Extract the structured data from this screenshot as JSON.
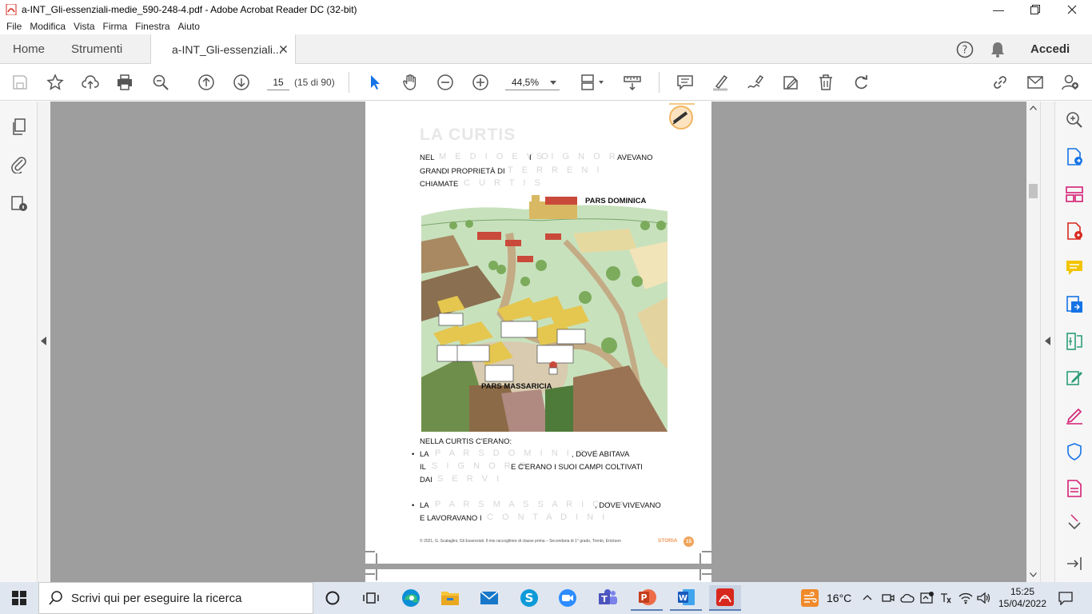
{
  "window": {
    "title": "a-INT_Gli-essenziali-medie_590-248-4.pdf - Adobe Acrobat Reader DC (32-bit)"
  },
  "menu": [
    "File",
    "Modifica",
    "Vista",
    "Firma",
    "Finestra",
    "Aiuto"
  ],
  "tabs": {
    "home": "Home",
    "tools": "Strumenti",
    "doc": "a-INT_Gli-essenziali...",
    "signin": "Accedi"
  },
  "toolbar": {
    "page_current": "15",
    "page_total": "(15 di 90)",
    "zoom": "44,5%"
  },
  "page": {
    "title": "LA CURTIS",
    "line1a": "NEL",
    "line1b": "M E D I O E V O",
    "line1c": "I",
    "line1d": "S I G N O R I",
    "line1e": "AVEVANO",
    "line2a": "GRANDI PROPRIETÀ DI",
    "line2b": "T E R R E N I",
    "line3a": "CHIAMATE",
    "line3b": "C U R T I S",
    "label_dominica": "PARS DOMINICA",
    "label_massaricia": "PARS MASSARICIA",
    "intro": "NELLA CURTIS C'ERANO:",
    "b1a": "LA",
    "b1b": "P A R S   D O M I N I C A",
    "b1c": ", DOVE ABITAVA",
    "b1d": "IL",
    "b1e": "S I G N O R E",
    "b1f": "E C'ERANO I SUOI CAMPI COLTIVATI",
    "b1g": "DAI",
    "b1h": "S E R V I",
    "b2a": "LA",
    "b2b": "P A R S   M A S S A R I C I A",
    "b2c": ", DOVE VIVEVANO",
    "b2d": "E LAVORAVANO I",
    "b2e": "C O N T A D I N I",
    "footer": "© 2021, G. Scalaglini, Gli Essenziali. Il mio raccoglitore di classe prima – Secondaria di 1° grado, Trento, Erickson",
    "section": "STORIA",
    "page_number": "15"
  },
  "taskbar": {
    "search_placeholder": "Scrivi qui per eseguire la ricerca",
    "weather": "16°C",
    "time": "15:25",
    "date": "15/04/2022"
  },
  "colors": {
    "acrobat_red": "#d7281e",
    "accent_blue": "#1473e6",
    "comment_yellow": "#f2c500",
    "sign_pink": "#d41f73",
    "tool_green": "#2d9d78"
  }
}
